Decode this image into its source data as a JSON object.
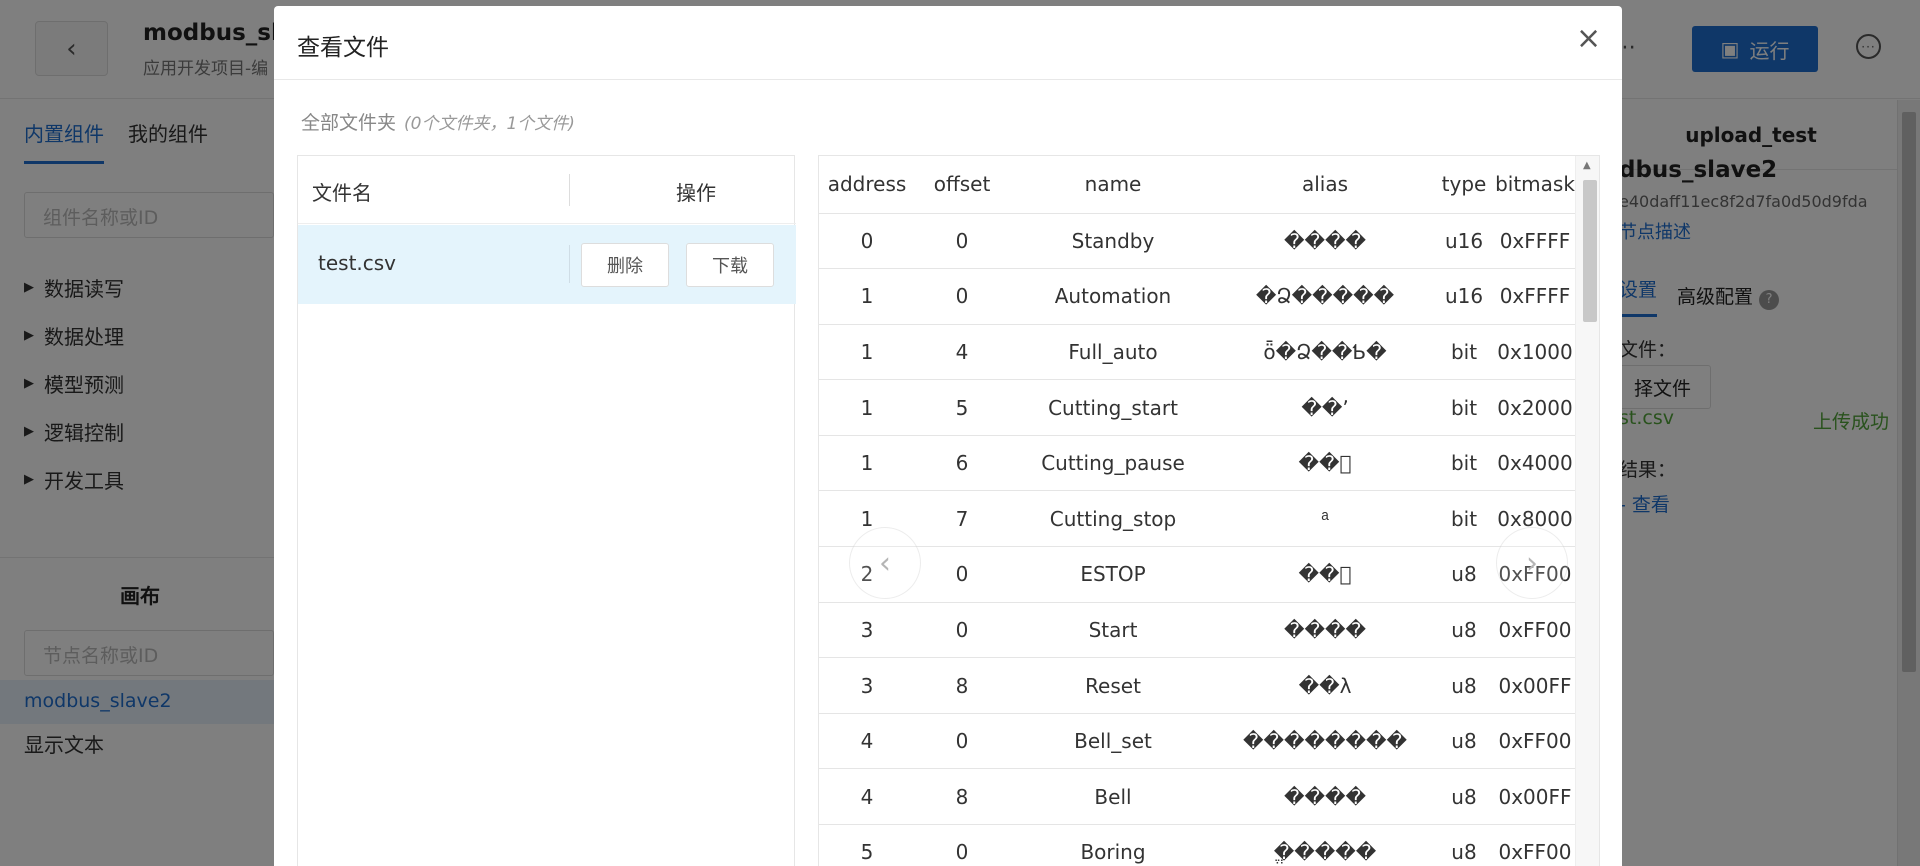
{
  "app": {
    "back_glyph": "‹",
    "project_title": "modbus_sla",
    "project_sub": "应用开发项目-编",
    "run_label": "运行",
    "left_tabs": [
      "内置组件",
      "我的组件"
    ],
    "component_search_placeholder": "组件名称或ID",
    "tree_items": [
      "数据读写",
      "数据处理",
      "模型预测",
      "逻辑控制",
      "开发工具"
    ],
    "canvas_title": "画布",
    "node_search_placeholder": "节点名称或ID",
    "node_selected": "modbus_slave2",
    "node_item": "显示文本"
  },
  "right_panel": {
    "title": "upload_test",
    "name": "dbus_slave2",
    "id": "e40daff11ec8f2d7fa0d50d9fda",
    "desc_link": "节点描述",
    "tab_active": "设置",
    "tab_other": "高级配置",
    "file_label": "文件：",
    "choose_file": "择文件",
    "file_name": "st.csv",
    "upload_ok": "上传成功",
    "result_label": "结果：",
    "view_link": "- 查看"
  },
  "modal": {
    "title": "查看文件",
    "close": "×",
    "crumb": "全部文件夹",
    "crumb_note": "(0个文件夹，1个文件)",
    "files_head_name": "文件名",
    "files_head_op": "操作",
    "file_name": "test.csv",
    "delete_label": "删除",
    "download_label": "下载",
    "prev_glyph": "‹",
    "next_glyph": "›"
  },
  "table": {
    "headers": [
      "address",
      "offset",
      "name",
      "alias",
      "type",
      "bitmask"
    ],
    "rows": [
      [
        "0",
        "0",
        "Standby",
        "����",
        "u16",
        "0xFFFF"
      ],
      [
        "1",
        "0",
        "Automation",
        "�Ձ�����",
        "u16",
        "0xFFFF"
      ],
      [
        "1",
        "4",
        "Full_auto",
        "ȫ�Ձ��Ƅ�",
        "bit",
        "0x1000"
      ],
      [
        "1",
        "5",
        "Cutting_start",
        "��ʼ",
        "bit",
        "0x2000"
      ],
      [
        "1",
        "6",
        "Cutting_pause",
        "��ͣ",
        "bit",
        "0x4000"
      ],
      [
        "1",
        "7",
        "Cutting_stop",
        "ͣ",
        "bit",
        "0x8000"
      ],
      [
        "2",
        "0",
        "ESTOP",
        "��ͣ",
        "u8",
        "0xFF00"
      ],
      [
        "3",
        "0",
        "Start",
        "����",
        "u8",
        "0xFF00"
      ],
      [
        "3",
        "8",
        "Reset",
        "��λ",
        "u8",
        "0x00FF"
      ],
      [
        "4",
        "0",
        "Bell_set",
        "��������",
        "u8",
        "0xFF00"
      ],
      [
        "4",
        "8",
        "Bell",
        "����",
        "u8",
        "0x00FF"
      ],
      [
        "5",
        "0",
        "Boring",
        "ֱ�����",
        "u8",
        "0xFF00"
      ]
    ]
  }
}
